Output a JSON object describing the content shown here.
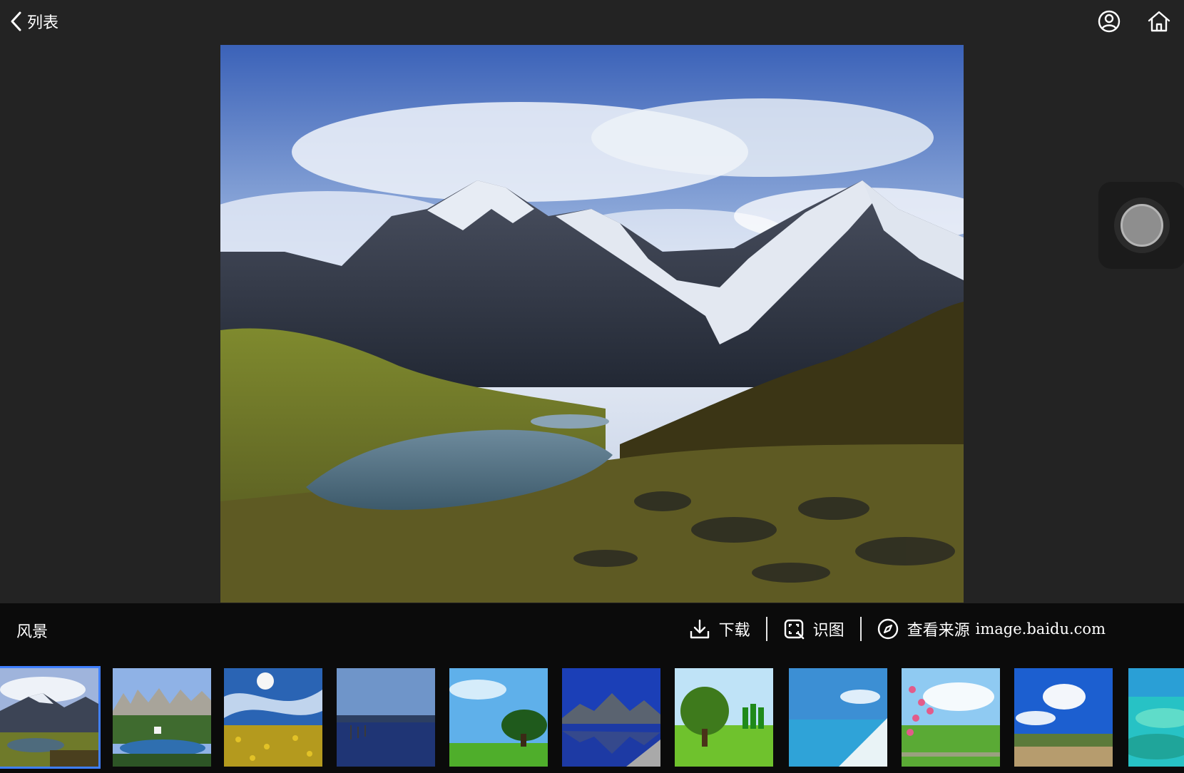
{
  "header": {
    "back_label": "列表"
  },
  "image": {
    "title": "风景"
  },
  "actions": {
    "download_label": "下载",
    "identify_label": "识图",
    "source_label": "查看来源",
    "source_domain": "image.baidu.com"
  },
  "thumbnails": {
    "selected_index": 0,
    "count": 11
  },
  "colors": {
    "background": "#232323",
    "bar": "#0b0b0b",
    "selection": "#3f7fff"
  }
}
